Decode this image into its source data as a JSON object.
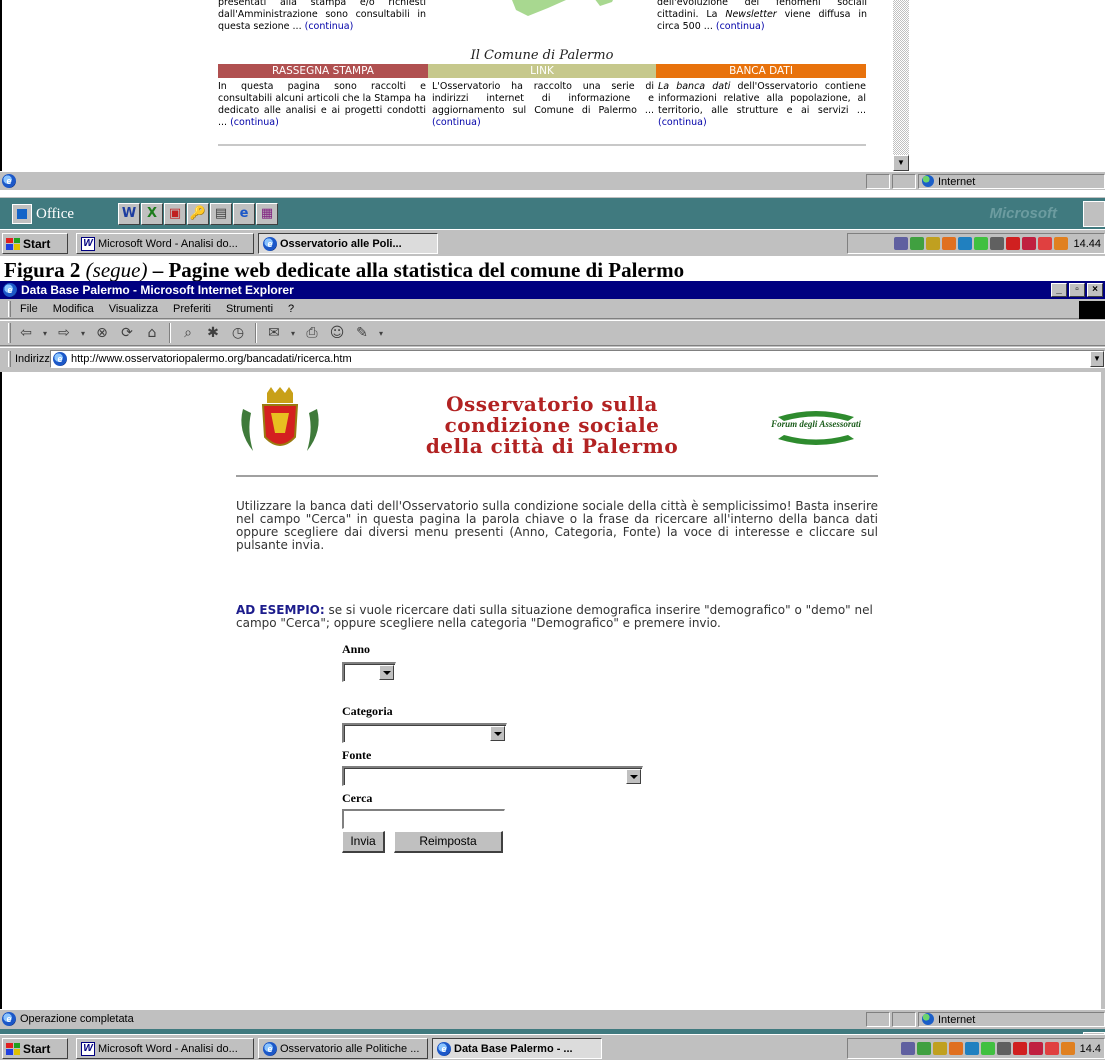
{
  "fragment": {
    "col1_top": "presentati alla stampa e/o richiesti dall'Amministrazione sono consultabili in questa sezione ... ",
    "col3_top_1": "dell'evoluzione dei fenomeni sociali cittadini. La ",
    "col3_top_italic": "Newsletter",
    "col3_top_2": " viene diffusa in circa 500 ... ",
    "continue_label": "(continua)",
    "section_title": "Il Comune di Palermo",
    "headers": [
      {
        "label": "RASSEGNA STAMPA",
        "color": "#b05050"
      },
      {
        "label": "LINK",
        "color": "#c6c88c"
      },
      {
        "label": "BANCA DATI",
        "color": "#e8720c"
      }
    ],
    "col1_text": "In questa pagina sono raccolti e consultabili alcuni articoli che la Stampa ha dedicato alle analisi e ai progetti condotti ... ",
    "col2_text": "L'Osservatorio ha raccolto una serie di indirizzi internet di informazione e aggiornamento sul Comune di Palermo ... ",
    "col3_italic": "La banca dati",
    "col3_text": " dell'Osservatorio contiene informazioni relative alla popolazione, al territorio, alle strutture e ai servizi ... ",
    "status_text": "",
    "status_zone": "Internet"
  },
  "taskbar1": {
    "start_label": "Start",
    "buttons": [
      {
        "label": "Microsoft Word - Analisi do..."
      },
      {
        "label": "Osservatorio alle Poli..."
      }
    ],
    "clock": "14.44"
  },
  "office_bar": {
    "office_label": "Office",
    "brand": "Microsoft"
  },
  "caption": {
    "prefix": "Figura 2 ",
    "italic": "(segue)",
    "suffix": " – Pagine web dedicate alla statistica del comune di Palermo"
  },
  "browser": {
    "title": "Data Base Palermo - Microsoft Internet Explorer",
    "menu": [
      "File",
      "Modifica",
      "Visualizza",
      "Preferiti",
      "Strumenti",
      "?"
    ],
    "address_label": "Indirizzo",
    "address_url": "http://www.osservatoriopalermo.org/bancadati/ricerca.htm",
    "status_text": "Operazione completata",
    "status_zone": "Internet"
  },
  "page": {
    "title_line1": "Osservatorio sulla",
    "title_line2": "condizione sociale",
    "title_line3": "della città di Palermo",
    "forum_label": "Forum degli Assessorati",
    "intro": "Utilizzare la banca dati dell'Osservatorio sulla condizione sociale della città è semplicissimo! Basta inserire nel campo \"Cerca\" in questa pagina la parola chiave o la frase da ricercare all'interno della banca dati oppure scegliere dai diversi menu presenti (Anno, Categoria, Fonte) la voce di interesse e cliccare sul pulsante invia.",
    "example_label": "AD ESEMPIO:",
    "example_text": " se si vuole ricercare dati sulla situazione demografica inserire \"demografico\" o \"demo\" nel campo \"Cerca\"; oppure scegliere nella categoria \"Demografico\" e premere invio.",
    "form": {
      "anno_label": "Anno",
      "categoria_label": "Categoria",
      "fonte_label": "Fonte",
      "cerca_label": "Cerca",
      "cerca_value": "",
      "submit_label": "Invia",
      "reset_label": "Reimposta"
    }
  },
  "taskbar2": {
    "start_label": "Start",
    "buttons": [
      {
        "label": "Microsoft Word - Analisi do..."
      },
      {
        "label": "Osservatorio alle Politiche ..."
      },
      {
        "label": "Data Base Palermo - ..."
      }
    ],
    "clock": "14.4"
  }
}
